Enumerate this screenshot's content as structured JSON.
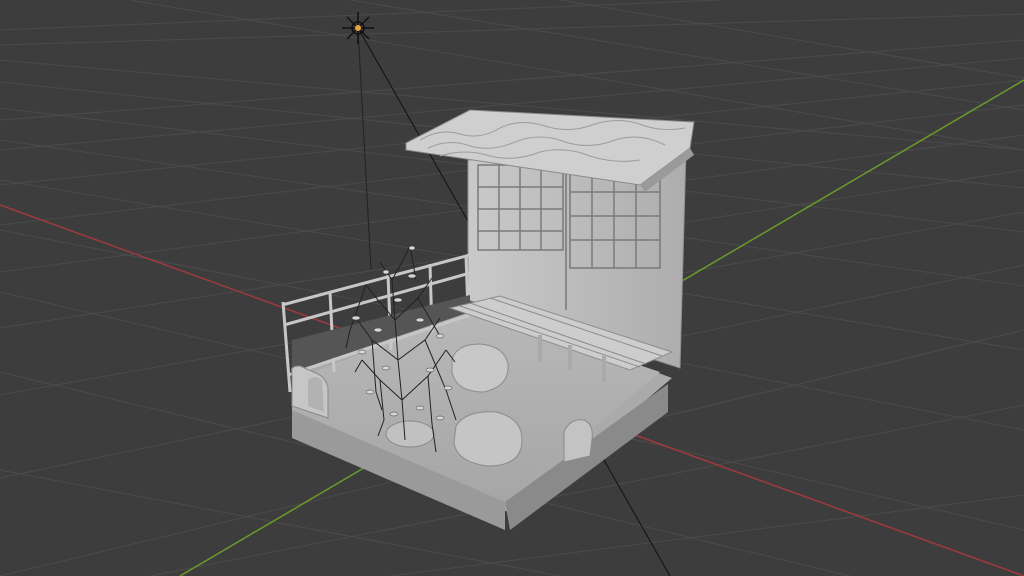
{
  "app": "3D Viewport",
  "scene": {
    "objects": [
      "light",
      "roof",
      "wall",
      "window",
      "bench",
      "fence",
      "tree",
      "rock",
      "stone",
      "base"
    ]
  },
  "colors": {
    "background": "#3d3d3d",
    "grid": "#4a4a4a",
    "x_axis": "#a0393f",
    "y_axis": "#6c9a2a",
    "model": "#b9b9b9",
    "model_shadow": "#8d8d8d",
    "light": "#e8a33a"
  },
  "icons": {
    "light": "sun-light-icon"
  }
}
